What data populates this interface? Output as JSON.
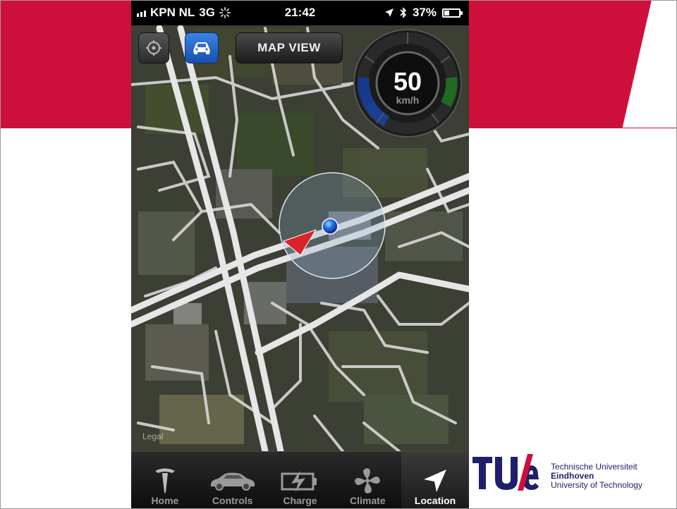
{
  "slide": {
    "accent_color": "#cf0f3b",
    "logo": {
      "letters": "TU/e",
      "line1": "Technische Universiteit",
      "line2": "Eindhoven",
      "line3": "University of Technology",
      "color": "#1f1f6b"
    }
  },
  "status_bar": {
    "carrier": "KPN NL",
    "network": "3G",
    "time": "21:42",
    "battery": "37%",
    "battery_level": 0.37
  },
  "toolbar": {
    "locate_icon": "crosshair-icon",
    "car_icon": "car-icon",
    "map_view_label": "MAP VIEW"
  },
  "speedometer": {
    "value": "50",
    "unit": "km/h"
  },
  "map": {
    "legal_label": "Legal"
  },
  "tabs": [
    {
      "label": "Home",
      "icon": "tesla-logo-icon",
      "active": false
    },
    {
      "label": "Controls",
      "icon": "car-icon",
      "active": false
    },
    {
      "label": "Charge",
      "icon": "battery-charge-icon",
      "active": false
    },
    {
      "label": "Climate",
      "icon": "fan-icon",
      "active": false
    },
    {
      "label": "Location",
      "icon": "location-arrow-icon",
      "active": true
    }
  ]
}
